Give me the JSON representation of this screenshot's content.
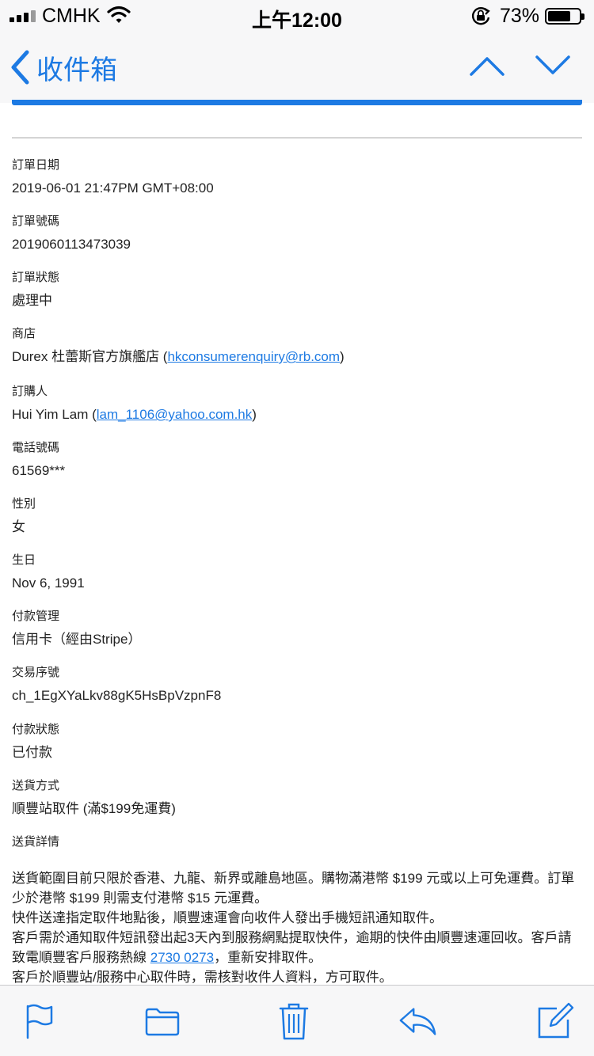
{
  "status_bar": {
    "carrier": "CMHK",
    "time": "上午12:00",
    "battery_percent": "73%",
    "battery_level": 0.73,
    "icons": [
      "signal-icon",
      "wifi-icon",
      "rotation-lock-icon",
      "battery-icon"
    ]
  },
  "nav": {
    "back_label": "收件箱",
    "icons": [
      "chevron-left-icon",
      "chevron-up-icon",
      "chevron-down-icon"
    ],
    "accent_color": "#1d7ae3"
  },
  "order": {
    "date": {
      "label": "訂單日期",
      "value": "2019-06-01 21:47PM GMT+08:00"
    },
    "number": {
      "label": "訂單號碼",
      "value": "2019060113473039"
    },
    "status": {
      "label": "訂單狀態",
      "value": "處理中"
    },
    "store": {
      "label": "商店",
      "name": "Durex 杜蕾斯官方旗艦店",
      "open": " (",
      "email": "hkconsumerenquiry@rb.com",
      "close": ")"
    },
    "buyer": {
      "label": "訂購人",
      "name": "Hui Yim Lam",
      "open": " (",
      "email": "lam_1106@yahoo.com.hk",
      "close": ")"
    },
    "phone": {
      "label": "電話號碼",
      "value": "61569***"
    },
    "gender": {
      "label": "性別",
      "value": "女"
    },
    "birthday": {
      "label": "生日",
      "value": "Nov 6, 1991"
    },
    "payment_method": {
      "label": "付款管理",
      "value": "信用卡（經由Stripe）"
    },
    "transaction_id": {
      "label": "交易序號",
      "value": "ch_1EgXYaLkv88gK5HsBpVzpnF8"
    },
    "payment_status": {
      "label": "付款狀態",
      "value": "已付款"
    },
    "delivery_method": {
      "label": "送貨方式",
      "value": "順豐站取件 (滿$199免運費)"
    },
    "delivery_details": {
      "label": "送貨詳情",
      "p1": "送貨範圍目前只限於香港、九龍、新界或離島地區。購物滿港幣 $199 元或以上可免運費。訂單少於港幣 $199 則需支付港幣 $15 元運費。",
      "p2": "快件送達指定取件地點後，順豐速運會向收件人發出手機短訊通知取件。",
      "p3_before": "客戶需於通知取件短訊發出起3天內到服務網點提取快件，逾期的快件由順豐速運回收。客戶請致電順豐客戶服務熱線 ",
      "p3_phone": "2730 0273",
      "p3_after": "，重新安排取件。",
      "p4": "客戶於順豐站/服務中心取件時，需核對收件人資料，方可取件。"
    }
  },
  "toolbar": {
    "icons": [
      "flag-icon",
      "folder-icon",
      "trash-icon",
      "reply-icon",
      "compose-icon"
    ]
  }
}
